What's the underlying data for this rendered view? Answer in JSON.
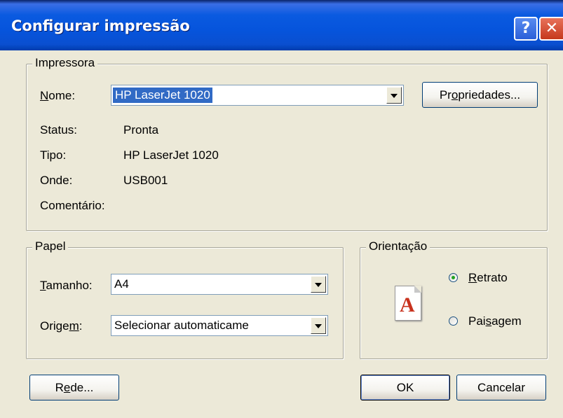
{
  "window": {
    "title": "Configurar impressão",
    "help_glyph": "?",
    "close_glyph": "✕"
  },
  "printer": {
    "group_label": "Impressora",
    "name_label_u": "N",
    "name_label_rest": "ome:",
    "name_value": "HP LaserJet 1020",
    "properties_pre": "Pr",
    "properties_u": "o",
    "properties_post": "priedades...",
    "status_label": "Status:",
    "status_value": "Pronta",
    "type_label": "Tipo:",
    "type_value": "HP LaserJet 1020",
    "where_label": "Onde:",
    "where_value": "USB001",
    "comment_label": "Comentário:"
  },
  "paper": {
    "group_label": "Papel",
    "size_label_u": "T",
    "size_label_rest": "amanho:",
    "size_value": "A4",
    "source_label_pre": "Orige",
    "source_label_u": "m",
    "source_label_post": ":",
    "source_value": "Selecionar automaticame"
  },
  "orientation": {
    "group_label": "Orientação",
    "portrait_u": "R",
    "portrait_rest": "etrato",
    "landscape_pre": "Pai",
    "landscape_u": "s",
    "landscape_post": "agem",
    "selected": "portrait",
    "icon": "page-letter-a-icon",
    "icon_letter": "A"
  },
  "buttons": {
    "network_pre": "R",
    "network_u": "e",
    "network_post": "de...",
    "ok": "OK",
    "cancel": "Cancelar"
  }
}
